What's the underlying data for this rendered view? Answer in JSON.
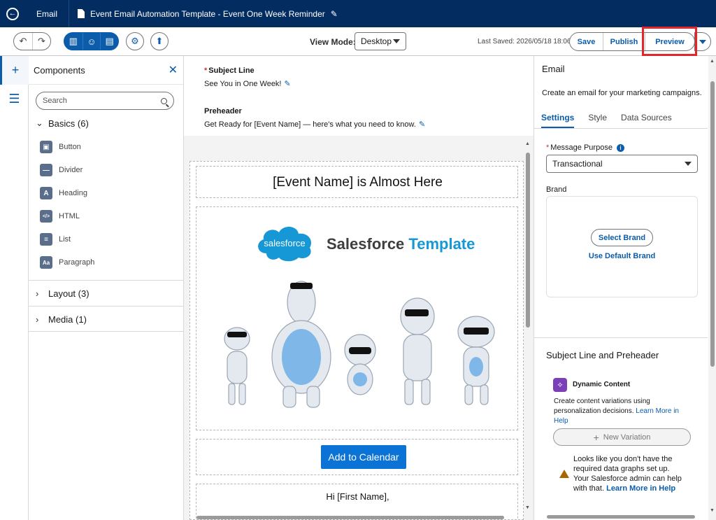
{
  "header": {
    "app_label": "Email",
    "doc_title": "Event Email Automation Template - Event One Week Reminder"
  },
  "toolbar": {
    "view_mode_label": "View Mode:",
    "view_mode_value": "Desktop",
    "last_saved": "Last Saved: 2026/05/18 18:06",
    "save_label": "Save",
    "publish_label": "Publish",
    "preview_label": "Preview"
  },
  "components": {
    "title": "Components",
    "search_placeholder": "Search",
    "basics_label": "Basics (6)",
    "items": [
      {
        "label": "Button",
        "icon": "button-icon",
        "glyph": "▣"
      },
      {
        "label": "Divider",
        "icon": "divider-icon",
        "glyph": "—"
      },
      {
        "label": "Heading",
        "icon": "heading-icon",
        "glyph": "A"
      },
      {
        "label": "HTML",
        "icon": "html-icon",
        "glyph": "</>"
      },
      {
        "label": "List",
        "icon": "list-icon",
        "glyph": "≡"
      },
      {
        "label": "Paragraph",
        "icon": "paragraph-icon",
        "glyph": "Aa"
      }
    ],
    "layout_label": "Layout (3)",
    "media_label": "Media (1)"
  },
  "email": {
    "subject_label": "Subject Line",
    "subject_value": "See You in One Week!",
    "preheader_label": "Preheader",
    "preheader_value": "Get Ready for [Event Name] — here's what you need to know.",
    "heading": "[Event Name] is Almost Here",
    "logo_text": "salesforce",
    "brand_main": "Salesforce",
    "brand_template": "Template",
    "cta_label": "Add to Calendar",
    "greeting": "Hi [First Name],"
  },
  "right_panel": {
    "title": "Email",
    "description": "Create an email for your marketing campaigns.",
    "tabs": [
      "Settings",
      "Style",
      "Data Sources"
    ],
    "purpose_label": "Message Purpose",
    "purpose_value": "Transactional",
    "brand_label": "Brand",
    "select_brand": "Select Brand",
    "use_default_brand": "Use Default Brand",
    "subject_section": "Subject Line and Preheader",
    "dynamic_title": "Dynamic Content",
    "dynamic_desc": "Create content variations using personalization decisions.",
    "learn_more": "Learn More in Help",
    "new_variation": "New Variation",
    "warning_text": "Looks like you don't have the required data graphs set up. Your Salesforce admin can help with that.",
    "warning_link": "Learn More in Help"
  },
  "colors": {
    "header_bg": "#032d60",
    "brand_blue": "#0b5cab",
    "cta_blue": "#0b73d6",
    "highlight_red": "#e3262a"
  }
}
